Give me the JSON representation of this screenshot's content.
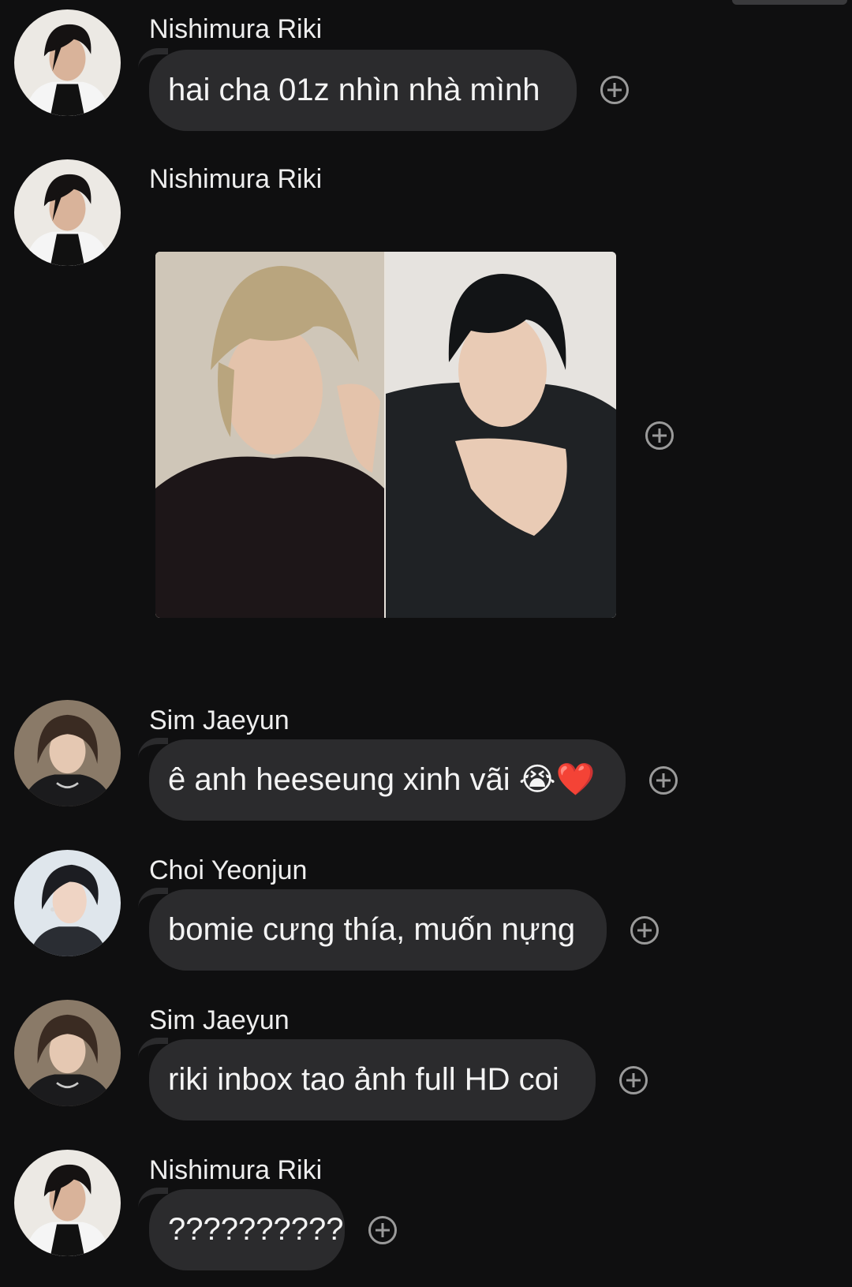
{
  "messages": [
    {
      "sender": "Nishimura Riki",
      "type": "text",
      "text": "hai cha 01z nhìn nhà mình"
    },
    {
      "sender": "Nishimura Riki",
      "type": "image",
      "image_alt": ""
    },
    {
      "sender": "Sim Jaeyun",
      "type": "text",
      "text": "ê anh heeseung xinh vãi",
      "emojis": "😭❤️"
    },
    {
      "sender": "Choi Yeonjun",
      "type": "text",
      "text": "bomie cưng thía, muốn nựng"
    },
    {
      "sender": "Sim Jaeyun",
      "type": "text",
      "text": "riki inbox tao ảnh full HD coi"
    },
    {
      "sender": "Nishimura Riki",
      "type": "text",
      "text": "??????????"
    }
  ],
  "icons": {
    "react": "add-reaction-icon"
  },
  "colors": {
    "background": "#0f0f10",
    "bubble": "#2b2b2d",
    "text": "#f2f2f2",
    "icon": "#9a9a9a"
  }
}
